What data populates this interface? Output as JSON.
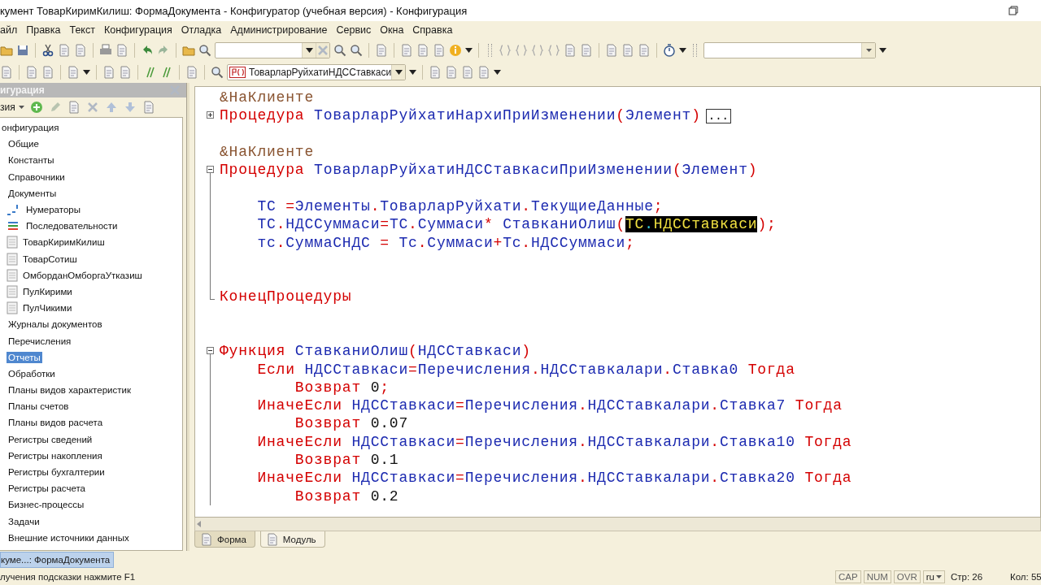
{
  "window": {
    "title": "кумент ТоварКиримКилиш: ФормаДокумента - Конфигуратор (учебная версия) - Конфигурация"
  },
  "menu": [
    "айл",
    "Правка",
    "Текст",
    "Конфигурация",
    "Отладка",
    "Администрирование",
    "Сервис",
    "Окна",
    "Справка"
  ],
  "toolbar": {
    "module_combo": "ТоварларРуйхатиНДССтавкаси"
  },
  "tree_panel": {
    "title": "игурация",
    "actions_label": "зия",
    "root": {
      "label": "онфигурация",
      "selected": false,
      "children": [
        {
          "label": "Общие",
          "selected": false
        },
        {
          "label": "Константы",
          "selected": false
        },
        {
          "label": "Справочники",
          "selected": false
        },
        {
          "label": "Документы",
          "selected": false,
          "children": [
            {
              "label": "Нумераторы",
              "selected": false,
              "kind": "numbers"
            },
            {
              "label": "Последовательности",
              "selected": false,
              "kind": "arrows"
            },
            {
              "label": "ТоварКиримКилиш",
              "selected": false,
              "kind": "document"
            },
            {
              "label": "ТоварСотиш",
              "selected": false,
              "kind": "document"
            },
            {
              "label": "ОмборданОмборгаУтказиш",
              "selected": false,
              "kind": "document"
            },
            {
              "label": "ПулКирими",
              "selected": false,
              "kind": "document"
            },
            {
              "label": "ПулЧикими",
              "selected": false,
              "kind": "document"
            }
          ]
        },
        {
          "label": "Журналы документов",
          "selected": false
        },
        {
          "label": "Перечисления",
          "selected": false
        },
        {
          "label": "Отчеты",
          "selected": true
        },
        {
          "label": "Обработки",
          "selected": false
        },
        {
          "label": "Планы видов характеристик",
          "selected": false
        },
        {
          "label": "Планы счетов",
          "selected": false
        },
        {
          "label": "Планы видов расчета",
          "selected": false
        },
        {
          "label": "Регистры сведений",
          "selected": false
        },
        {
          "label": "Регистры накопления",
          "selected": false
        },
        {
          "label": "Регистры бухгалтерии",
          "selected": false
        },
        {
          "label": "Регистры расчета",
          "selected": false
        },
        {
          "label": "Бизнес-процессы",
          "selected": false
        },
        {
          "label": "Задачи",
          "selected": false
        },
        {
          "label": "Внешние источники данных",
          "selected": false
        }
      ]
    }
  },
  "editor": {
    "lines": [
      {
        "kind": "plain",
        "tokens": [
          {
            "kind": "directive",
            "text": "&НаКлиенте"
          }
        ]
      },
      {
        "kind": "collapsed",
        "tokens": [
          {
            "kind": "keyword",
            "text": "Процедура "
          },
          {
            "kind": "ident",
            "text": "ТоварларРуйхатиНархиПриИзменении"
          },
          {
            "kind": "punct",
            "text": "("
          },
          {
            "kind": "ident",
            "text": "Элемент"
          },
          {
            "kind": "punct",
            "text": ")"
          },
          {
            "kind": "collapsed",
            "text": "..."
          }
        ]
      },
      {
        "kind": "plain"
      },
      {
        "kind": "plain",
        "tokens": [
          {
            "kind": "directive",
            "text": "&НаКлиенте"
          }
        ]
      },
      {
        "kind": "expanded",
        "tokens": [
          {
            "kind": "keyword",
            "text": "Процедура "
          },
          {
            "kind": "ident",
            "text": "ТоварларРуйхатиНДССтавкасиПриИзменении"
          },
          {
            "kind": "punct",
            "text": "("
          },
          {
            "kind": "ident",
            "text": "Элемент"
          },
          {
            "kind": "punct",
            "text": ")"
          }
        ]
      },
      {
        "kind": "inside"
      },
      {
        "kind": "inside",
        "tokens": [
          {
            "kind": "ident",
            "text": "    ТС "
          },
          {
            "kind": "punct",
            "text": "="
          },
          {
            "kind": "ident",
            "text": "Элементы"
          },
          {
            "kind": "punct",
            "text": "."
          },
          {
            "kind": "ident",
            "text": "ТоварларРуйхати"
          },
          {
            "kind": "punct",
            "text": "."
          },
          {
            "kind": "ident",
            "text": "ТекущиеДанные"
          },
          {
            "kind": "punct",
            "text": ";"
          }
        ]
      },
      {
        "kind": "inside",
        "tokens": [
          {
            "kind": "ident",
            "text": "    ТС"
          },
          {
            "kind": "punct",
            "text": "."
          },
          {
            "kind": "ident",
            "text": "НДССуммаси"
          },
          {
            "kind": "punct",
            "text": "="
          },
          {
            "kind": "ident",
            "text": "ТС"
          },
          {
            "kind": "punct",
            "text": "."
          },
          {
            "kind": "ident",
            "text": "Суммаси"
          },
          {
            "kind": "punct",
            "text": "* "
          },
          {
            "kind": "ident",
            "text": "СтавканиОлиш"
          },
          {
            "kind": "punct",
            "text": "("
          },
          {
            "kind": "match",
            "text": "ТС"
          },
          {
            "kind": "match-punct",
            "text": "."
          },
          {
            "kind": "match",
            "text": "НДССтавкаси"
          },
          {
            "kind": "punct",
            "text": ");"
          }
        ]
      },
      {
        "kind": "inside",
        "tokens": [
          {
            "kind": "ident",
            "text": "    тс"
          },
          {
            "kind": "punct",
            "text": "."
          },
          {
            "kind": "ident",
            "text": "СуммаСНДС "
          },
          {
            "kind": "punct",
            "text": "= "
          },
          {
            "kind": "ident",
            "text": "Тс"
          },
          {
            "kind": "punct",
            "text": "."
          },
          {
            "kind": "ident",
            "text": "Суммаси"
          },
          {
            "kind": "punct",
            "text": "+"
          },
          {
            "kind": "ident",
            "text": "Тс"
          },
          {
            "kind": "punct",
            "text": "."
          },
          {
            "kind": "ident",
            "text": "НДССуммаси"
          },
          {
            "kind": "punct",
            "text": ";"
          }
        ]
      },
      {
        "kind": "inside"
      },
      {
        "kind": "inside"
      },
      {
        "kind": "end",
        "tokens": [
          {
            "kind": "keyword",
            "text": "КонецПроцедуры"
          }
        ]
      },
      {
        "kind": "plain"
      },
      {
        "kind": "plain"
      },
      {
        "kind": "expanded",
        "tokens": [
          {
            "kind": "keyword",
            "text": "Функция "
          },
          {
            "kind": "ident",
            "text": "СтавканиОлиш"
          },
          {
            "kind": "punct",
            "text": "("
          },
          {
            "kind": "ident",
            "text": "НДССтавкаси"
          },
          {
            "kind": "punct",
            "text": ")"
          }
        ]
      },
      {
        "kind": "inside",
        "tokens": [
          {
            "kind": "keyword",
            "text": "    Если "
          },
          {
            "kind": "ident",
            "text": "НДССтавкаси"
          },
          {
            "kind": "punct",
            "text": "="
          },
          {
            "kind": "ident",
            "text": "Перечисления"
          },
          {
            "kind": "punct",
            "text": "."
          },
          {
            "kind": "ident",
            "text": "НДССтавкалари"
          },
          {
            "kind": "punct",
            "text": "."
          },
          {
            "kind": "ident",
            "text": "Ставка0 "
          },
          {
            "kind": "keyword",
            "text": "Тогда"
          }
        ]
      },
      {
        "kind": "inside",
        "tokens": [
          {
            "kind": "keyword",
            "text": "        Возврат "
          },
          {
            "kind": "number",
            "text": "0"
          },
          {
            "kind": "punct",
            "text": ";"
          }
        ]
      },
      {
        "kind": "inside",
        "tokens": [
          {
            "kind": "keyword",
            "text": "    ИначеЕсли "
          },
          {
            "kind": "ident",
            "text": "НДССтавкаси"
          },
          {
            "kind": "punct",
            "text": "="
          },
          {
            "kind": "ident",
            "text": "Перечисления"
          },
          {
            "kind": "punct",
            "text": "."
          },
          {
            "kind": "ident",
            "text": "НДССтавкалари"
          },
          {
            "kind": "punct",
            "text": "."
          },
          {
            "kind": "ident",
            "text": "Ставка7 "
          },
          {
            "kind": "keyword",
            "text": "Тогда"
          }
        ]
      },
      {
        "kind": "inside",
        "tokens": [
          {
            "kind": "keyword",
            "text": "        Возврат "
          },
          {
            "kind": "number",
            "text": "0.07"
          }
        ]
      },
      {
        "kind": "inside",
        "tokens": [
          {
            "kind": "keyword",
            "text": "    ИначеЕсли "
          },
          {
            "kind": "ident",
            "text": "НДССтавкаси"
          },
          {
            "kind": "punct",
            "text": "="
          },
          {
            "kind": "ident",
            "text": "Перечисления"
          },
          {
            "kind": "punct",
            "text": "."
          },
          {
            "kind": "ident",
            "text": "НДССтавкалари"
          },
          {
            "kind": "punct",
            "text": "."
          },
          {
            "kind": "ident",
            "text": "Ставка10 "
          },
          {
            "kind": "keyword",
            "text": "Тогда"
          }
        ]
      },
      {
        "kind": "inside",
        "tokens": [
          {
            "kind": "keyword",
            "text": "        Возврат "
          },
          {
            "kind": "number",
            "text": "0.1"
          }
        ]
      },
      {
        "kind": "inside",
        "tokens": [
          {
            "kind": "keyword",
            "text": "    ИначеЕсли "
          },
          {
            "kind": "ident",
            "text": "НДССтавкаси"
          },
          {
            "kind": "punct",
            "text": "="
          },
          {
            "kind": "ident",
            "text": "Перечисления"
          },
          {
            "kind": "punct",
            "text": "."
          },
          {
            "kind": "ident",
            "text": "НДССтавкалари"
          },
          {
            "kind": "punct",
            "text": "."
          },
          {
            "kind": "ident",
            "text": "Ставка20 "
          },
          {
            "kind": "keyword",
            "text": "Тогда"
          }
        ]
      },
      {
        "kind": "inside",
        "tokens": [
          {
            "kind": "keyword",
            "text": "        Возврат "
          },
          {
            "kind": "number",
            "text": "0.2"
          }
        ]
      }
    ],
    "tabs": [
      {
        "label": "Форма",
        "selected": true
      },
      {
        "label": "Модуль",
        "selected": false
      }
    ]
  },
  "window_tabs": [
    {
      "label": "куме...: ФормаДокумента",
      "selected": true
    }
  ],
  "status_bar": {
    "hint": "лучения подсказки нажмите F1",
    "indicators": [
      "CAP",
      "NUM",
      "OVR"
    ],
    "language": "ru",
    "line": "Стр: 26",
    "column": "Кол: 55"
  }
}
